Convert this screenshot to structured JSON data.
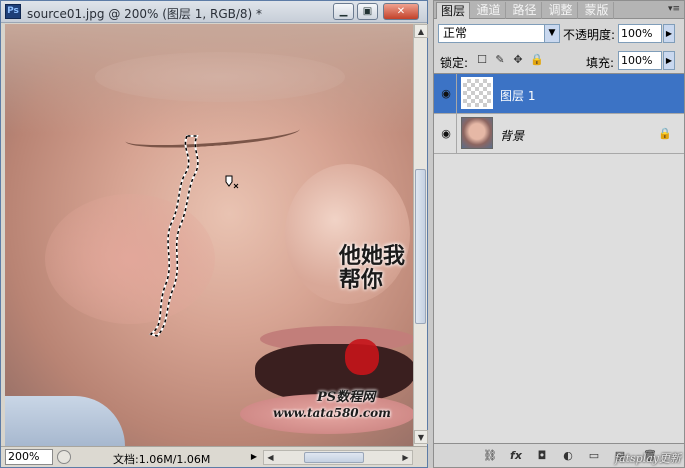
{
  "document": {
    "title": "source01.jpg @ 200% (图层 1, RGB/8) *",
    "logo": "Ps",
    "window_buttons": {
      "minimize": "▁",
      "maximize": "▣",
      "close": "✕"
    },
    "watermark": {
      "stamp_text": "他她我帮你",
      "line1": "PS数程网",
      "line2": "www.tata580.com"
    },
    "status": {
      "zoom": "200%",
      "doc_info": "文档:1.06M/1.06M",
      "arrow": "▶"
    },
    "scroll": {
      "up": "▲",
      "down": "▼",
      "left": "◀",
      "right": "▶"
    }
  },
  "layers_panel": {
    "tabs": [
      "图层",
      "通道",
      "路径",
      "调整",
      "蒙版"
    ],
    "menu_icon": "▾≡",
    "blend_mode": "正常",
    "blend_arrow": "▼",
    "opacity_label": "不透明度:",
    "opacity": "100%",
    "lock_label": "锁定:",
    "lock_icons": [
      "☐",
      "✎",
      "✥",
      "🔒"
    ],
    "fill_label": "填充:",
    "fill": "100%",
    "stepper_arrow": "▶",
    "layers": [
      {
        "name": "图层 1",
        "visible_icon": "◉",
        "selected": true
      },
      {
        "name": "背景",
        "visible_icon": "◉",
        "locked_icon": "🔒",
        "selected": false
      }
    ],
    "footer_icons": [
      "⛓",
      "fx",
      "◘",
      "◐",
      "▭",
      "▤",
      "🗑"
    ],
    "credit": "fatsplay更新"
  }
}
